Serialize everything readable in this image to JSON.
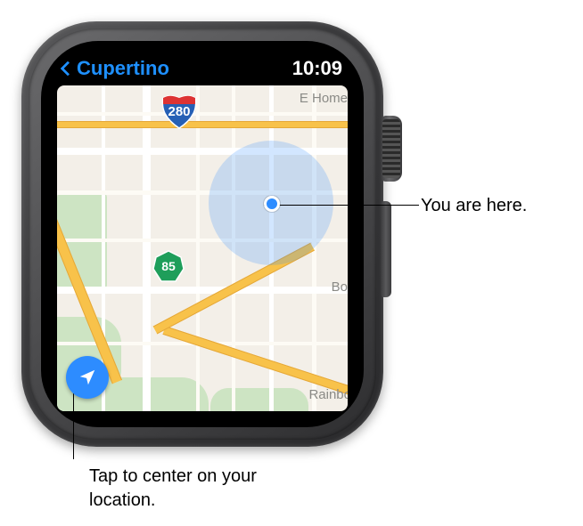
{
  "status": {
    "back_label": "Cupertino",
    "time": "10:09"
  },
  "map": {
    "shields": {
      "interstate": "280",
      "state": "85"
    },
    "edge_labels": {
      "ehome": "E Home",
      "bo": "Bo",
      "rainbo": "Rainbo"
    }
  },
  "icons": {
    "recenter": "location-arrow-icon",
    "back_chevron": "chevron-left-icon",
    "current_location": "location-dot-icon"
  },
  "callouts": {
    "you_are_here": "You are here.",
    "recenter_hint": "Tap to center on your location."
  }
}
